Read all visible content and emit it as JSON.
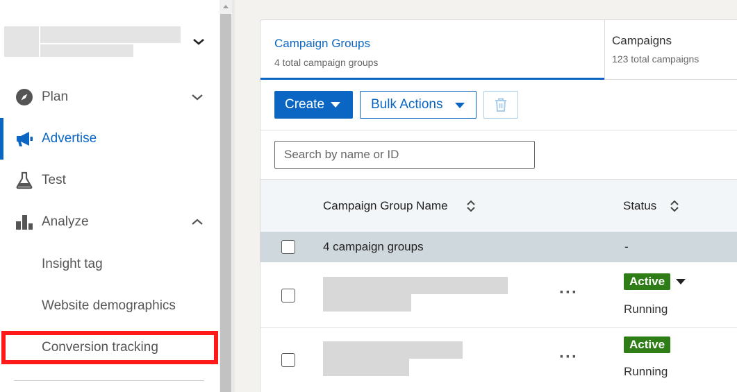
{
  "sidebar": {
    "nav": [
      {
        "label": "Plan",
        "icon": "compass-icon",
        "chevron": "down"
      },
      {
        "label": "Advertise",
        "icon": "megaphone-icon",
        "active": true
      },
      {
        "label": "Test",
        "icon": "flask-icon"
      },
      {
        "label": "Analyze",
        "icon": "bar-chart-icon",
        "chevron": "up"
      }
    ],
    "analyze_sub": [
      "Insight tag",
      "Website demographics",
      "Conversion tracking"
    ],
    "highlighted_item": "Conversion tracking"
  },
  "tabs": [
    {
      "title": "Campaign Groups",
      "subtitle": "4 total campaign groups",
      "selected": true
    },
    {
      "title": "Campaigns",
      "subtitle": "123 total campaigns"
    }
  ],
  "toolbar": {
    "create_label": "Create",
    "bulk_label": "Bulk Actions"
  },
  "search": {
    "placeholder": "Search by name or ID"
  },
  "table": {
    "columns": [
      "Campaign Group Name",
      "Status"
    ],
    "group_row": {
      "label": "4 campaign groups",
      "status": "-"
    },
    "rows": [
      {
        "status_badge": "Active",
        "status_text": "Running"
      },
      {
        "status_badge": "Active",
        "status_text": "Running"
      }
    ]
  },
  "colors": {
    "accent": "#0a66c2",
    "active_badge": "#2e7d17",
    "highlight": "#ff1a1a"
  }
}
